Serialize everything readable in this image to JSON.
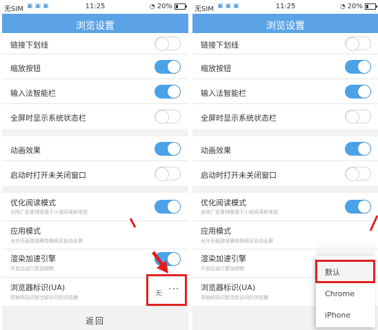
{
  "status_bar": {
    "carrier": "无SIM",
    "time": "11:25",
    "battery": "20%"
  },
  "page_title": "浏览设置",
  "settings": [
    {
      "label": "链接下划线",
      "desc": "",
      "toggle": "off"
    },
    {
      "label": "缩放按钮",
      "desc": "",
      "toggle": "on"
    },
    {
      "label": "输入法智能栏",
      "desc": "",
      "toggle": "on"
    },
    {
      "label": "全屏时显示系统状态栏",
      "desc": "",
      "toggle": "off"
    },
    {
      "label": "动画效果",
      "desc": "",
      "toggle": "on"
    },
    {
      "label": "启动时打开未关闭窗口",
      "desc": "",
      "toggle": "off"
    },
    {
      "label": "优化阅读模式",
      "desc": "去除广告重排版便于小说阅读新体验",
      "toggle": "on"
    },
    {
      "label": "应用模式",
      "desc": "允许页面游戏等特殊网页自动全屏",
      "toggle": "on"
    },
    {
      "label": "渲染加速引擎",
      "desc": "开启后运行更加顺畅",
      "toggle": "on"
    },
    {
      "label": "浏览器标识(UA)",
      "desc": "帮助网站识别当前访问的浏览器",
      "value": "无",
      "more": "···"
    }
  ],
  "back_label": "返回",
  "ua_menu": {
    "options": [
      "默认",
      "Chrome",
      "iPhone"
    ],
    "selected": "默认"
  },
  "colors": {
    "title_bar": "#5ba3e6",
    "toggle_on": "#4aa3e6",
    "highlight": "#e0201f"
  }
}
